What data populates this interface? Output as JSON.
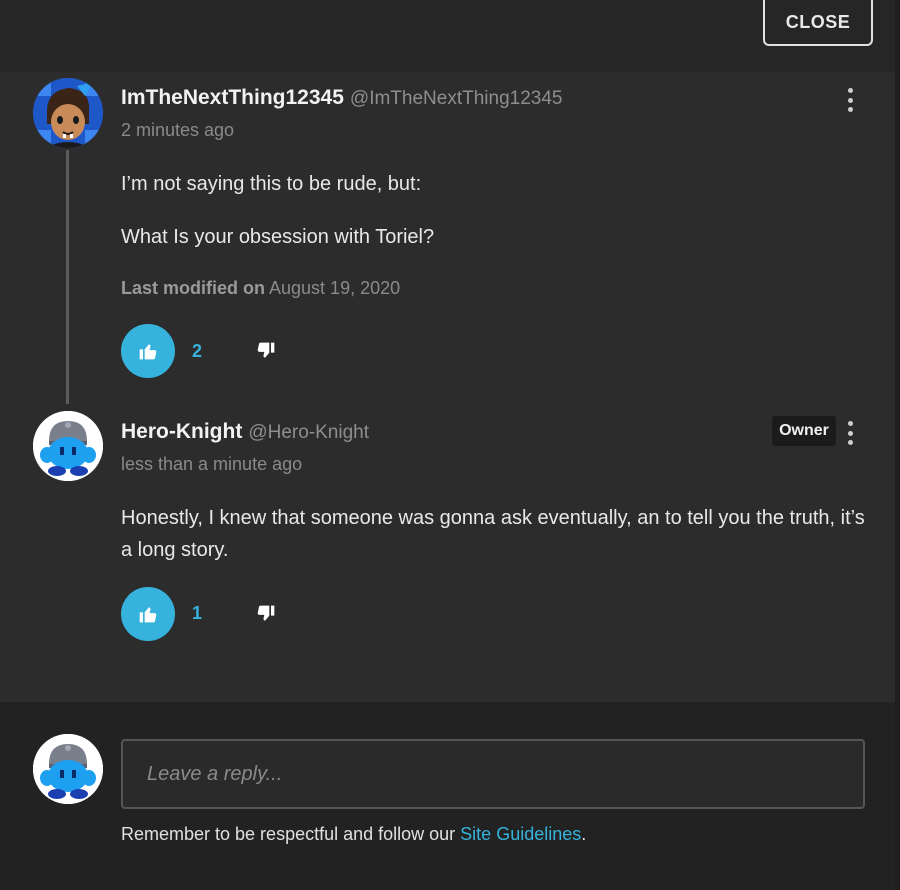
{
  "header": {
    "close_label": "CLOSE"
  },
  "comments": [
    {
      "author": "ImTheNextThing12345",
      "handle": "@ImTheNextThing12345",
      "time": "2 minutes ago",
      "paragraphs": [
        "I’m not saying this to be rude, but:",
        "What Is your obsession with Toriel?"
      ],
      "modified_label": "Last modified on",
      "modified_date": "August 19, 2020",
      "likes": "2"
    },
    {
      "author": "Hero-Knight",
      "handle": "@Hero-Knight",
      "badge": "Owner",
      "time": "less than a minute ago",
      "paragraphs": [
        "Honestly, I knew that someone was gonna ask eventually, an to tell you the truth, it’s a long story."
      ],
      "likes": "1"
    }
  ],
  "reply": {
    "placeholder": "Leave a reply...",
    "guidelines_prefix": "Remember to be respectful and follow our ",
    "guidelines_link": "Site Guidelines",
    "guidelines_suffix": "."
  },
  "colors": {
    "accent": "#36b3dc",
    "background": "#2c2c2c",
    "reply_background": "#222222"
  },
  "icons": [
    "kebab-menu-icon",
    "thumbs-up-icon",
    "thumbs-down-icon"
  ]
}
